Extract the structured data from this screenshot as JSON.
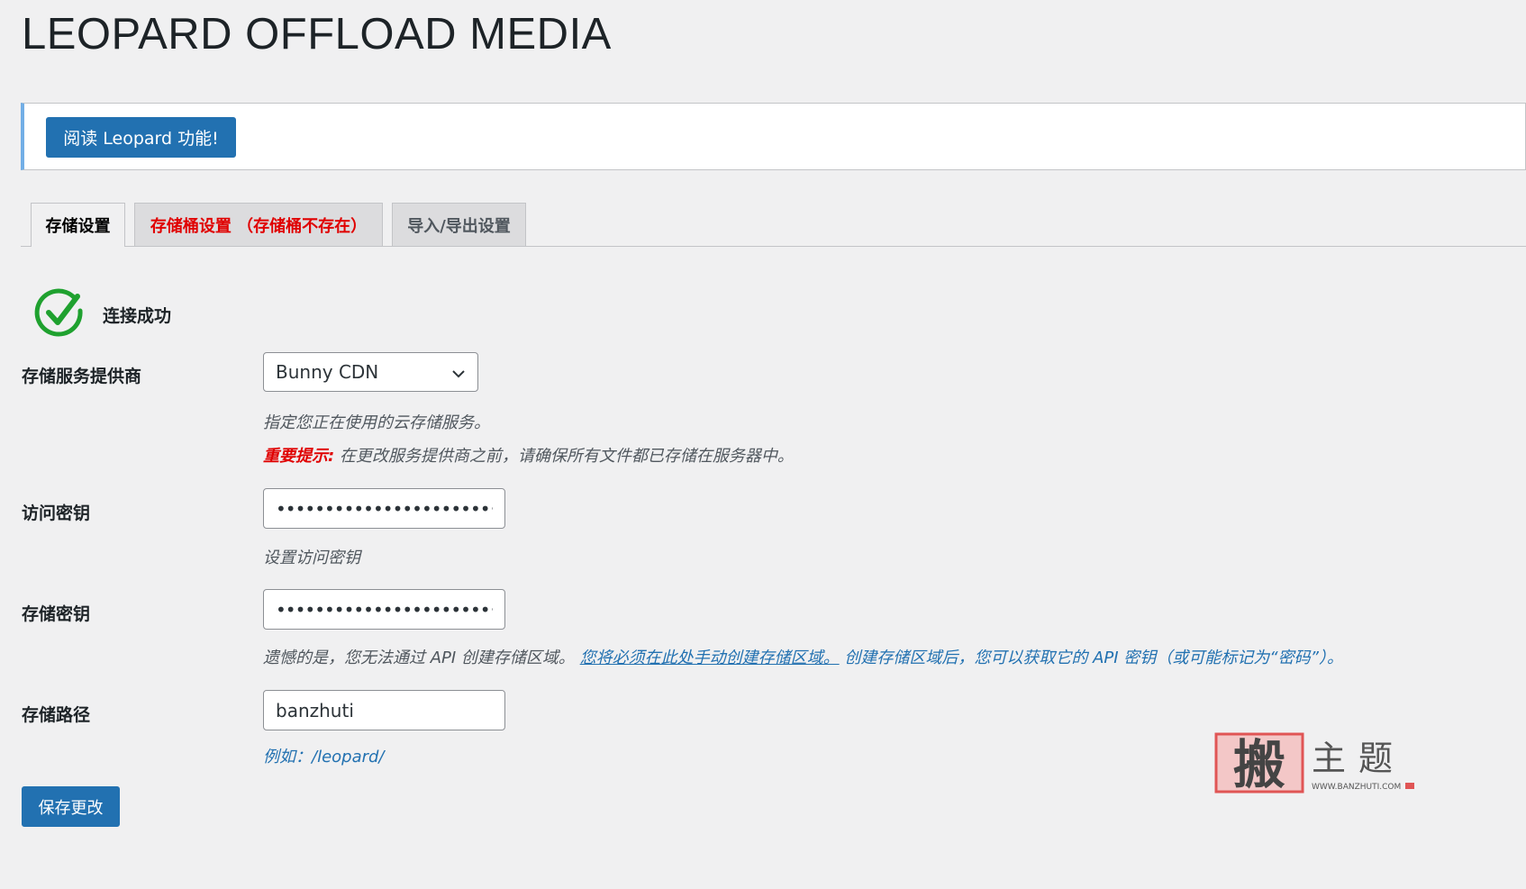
{
  "page": {
    "title": "LEOPARD OFFLOAD MEDIA"
  },
  "notice": {
    "button_label": "阅读 Leopard 功能!"
  },
  "tabs": [
    {
      "label": "存储设置",
      "active": true
    },
    {
      "label": "存储桶设置 （存储桶不存在）",
      "error": true
    },
    {
      "label": "导入/导出设置"
    }
  ],
  "status": {
    "text": "连接成功",
    "icon": "check-circle-icon",
    "color": "#1fa12f"
  },
  "form": {
    "provider": {
      "label": "存储服务提供商",
      "value": "Bunny CDN",
      "description": "指定您正在使用的云存储服务。",
      "warning_prefix": "重要提示:",
      "warning_text": " 在更改服务提供商之前，请确保所有文件都已存储在服务器中。"
    },
    "access_key": {
      "label": "访问密钥",
      "value": "••••••••••••••••••••••••••••••",
      "description": "设置访问密钥"
    },
    "secret_key": {
      "label": "存储密钥",
      "value": "••••••••••••••••••••••••••••••",
      "description_pre": "遗憾的是，您无法通过 API 创建存储区域。",
      "description_link": "您将必须在此处手动创建存储区域。",
      "description_post": "创建存储区域后，您可以获取它的 API 密钥（或可能标记为“密码”）。"
    },
    "path": {
      "label": "存储路径",
      "value": "banzhuti",
      "description": "例如：/leopard/"
    }
  },
  "save_button": "保存更改",
  "watermark": {
    "seal_char": "搬",
    "chars": "主题",
    "url": "WWW.BANZHUTI.COM"
  },
  "colors": {
    "primary": "#2271b1",
    "error": "#e00000",
    "notice_border": "#72aee6",
    "bg": "#f0f0f1"
  }
}
